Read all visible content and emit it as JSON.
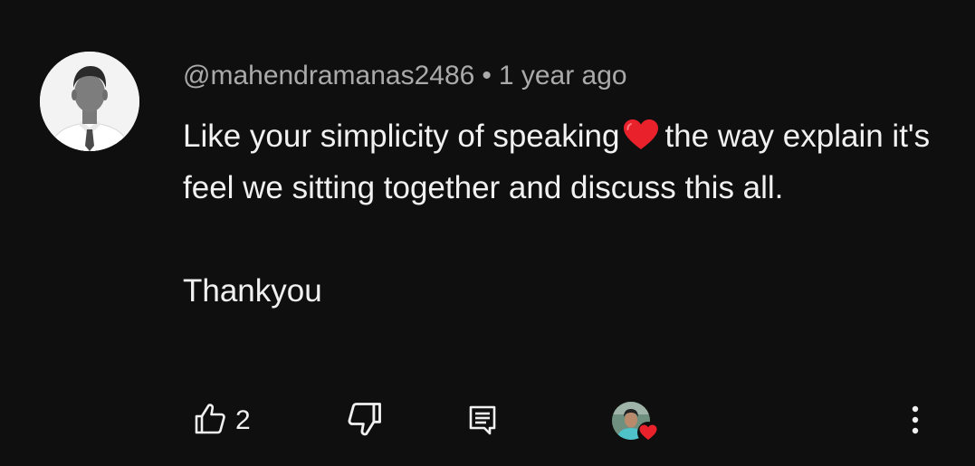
{
  "comment": {
    "author_handle": "@mahendramanas2486",
    "separator": "•",
    "timestamp": "1 year ago",
    "text_before_emoji": "Like your simplicity of speaking",
    "emoji": "heart-emoji",
    "text_after_emoji": "the way explain it's feel we sitting together and discuss this all.",
    "text_closing": "Thankyou",
    "like_count": "2"
  },
  "icons": {
    "like": "thumbs-up-icon",
    "dislike": "thumbs-down-icon",
    "reply": "reply-comment-icon",
    "creator_heart": "creator-heart-icon",
    "more": "more-vertical-icon"
  },
  "colors": {
    "background": "#0f0f0f",
    "primary_text": "#f1f1f1",
    "secondary_text": "#aaaaaa",
    "heart": "#e8212b"
  }
}
